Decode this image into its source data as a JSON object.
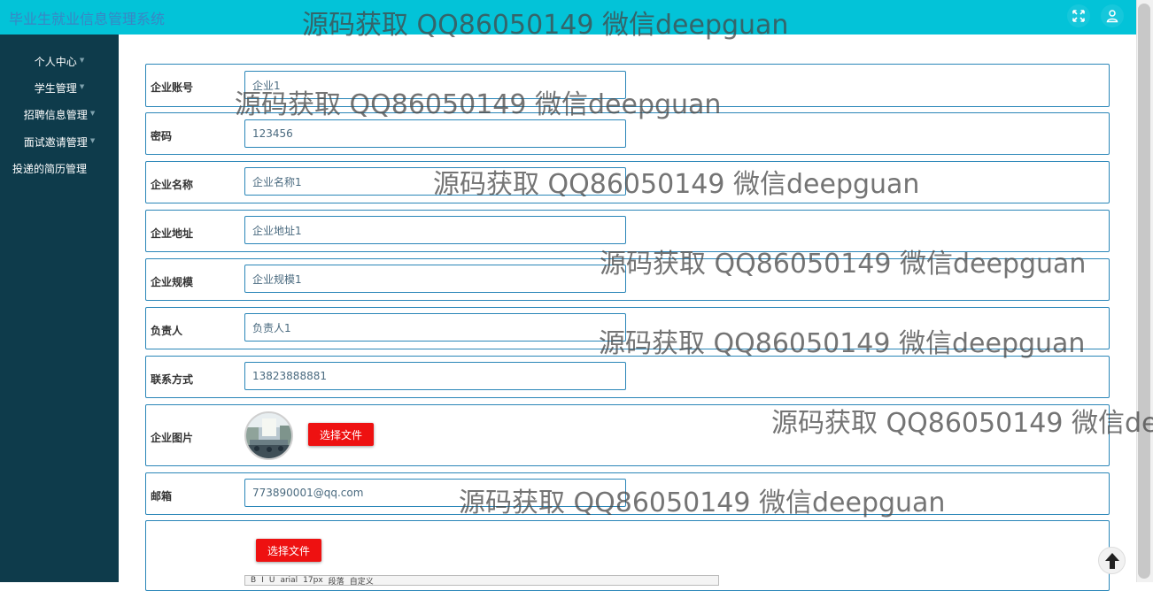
{
  "header": {
    "app_title": "毕业生就业信息管理系统",
    "buttons": [
      {
        "icon": "fullscreen-icon"
      },
      {
        "icon": "user-icon"
      }
    ]
  },
  "sidebar": {
    "items": [
      {
        "label": "个人中心",
        "has_caret": true
      },
      {
        "label": "学生管理",
        "has_caret": true
      },
      {
        "label": "招聘信息管理",
        "has_caret": true
      },
      {
        "label": "面试邀请管理",
        "has_caret": true
      },
      {
        "label": "投递的简历管理",
        "has_caret": false
      }
    ]
  },
  "form": {
    "fields": [
      {
        "label": "企业账号",
        "value": "企业1"
      },
      {
        "label": "密码",
        "value": "123456"
      },
      {
        "label": "企业名称",
        "value": "企业名称1"
      },
      {
        "label": "企业地址",
        "value": "企业地址1"
      },
      {
        "label": "企业规模",
        "value": "企业规模1"
      },
      {
        "label": "负责人",
        "value": "负责人1"
      },
      {
        "label": "联系方式",
        "value": "13823888881"
      }
    ],
    "image_field": {
      "label": "企业图片",
      "button": "选择文件"
    },
    "email_field": {
      "label": "邮箱",
      "value": "773890001@qq.com"
    },
    "editor_field": {
      "button": "选择文件",
      "toolbar": [
        "B",
        "I",
        "U",
        "arial",
        "17px",
        "段落",
        "自定义"
      ]
    }
  },
  "watermark": "源码获取 QQ86050149 微信deepguan",
  "colors": {
    "topbar": "#03c3d8",
    "sidebar": "#0e3b4b",
    "border": "#2a86b8",
    "file_button": "#ee1111"
  }
}
